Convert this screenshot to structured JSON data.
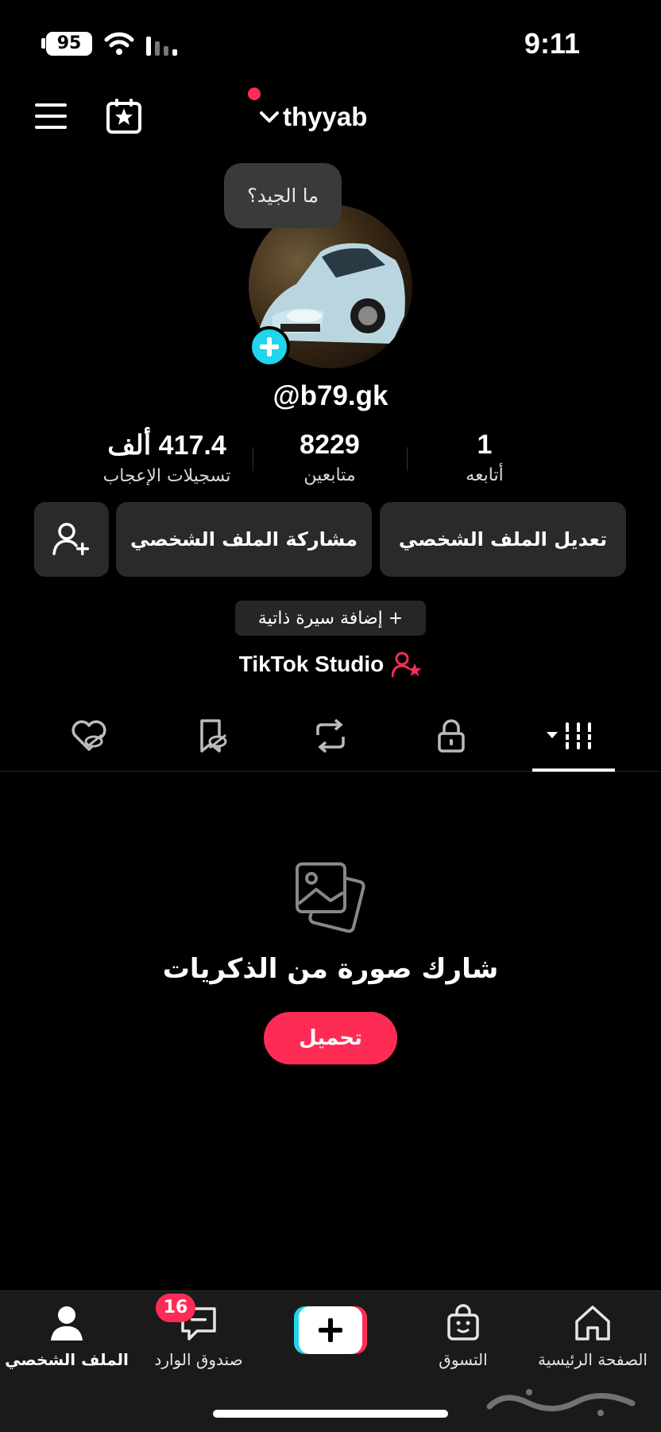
{
  "status_bar": {
    "battery": "95",
    "time": "9:11"
  },
  "header": {
    "username": "thyyab"
  },
  "profile": {
    "bubble_text": "ما الجيد؟",
    "handle": "@b79.gk",
    "stats": [
      {
        "value": "417.4 ألف",
        "label": "تسجيلات الإعجاب"
      },
      {
        "value": "8229",
        "label": "متابعين"
      },
      {
        "value": "1",
        "label": "أتابعه"
      }
    ],
    "edit_label": "تعديل الملف الشخصي",
    "share_label": "مشاركة الملف الشخصي",
    "bio_label": "+ إضافة سيرة ذاتية",
    "studio_label": "TikTok Studio"
  },
  "tabs": [
    "grid",
    "private",
    "reposts",
    "favorites",
    "liked"
  ],
  "empty_state": {
    "title": "شارك صورة من الذكريات",
    "button": "تحميل"
  },
  "bottom_nav": {
    "home": "الصفحة الرئيسية",
    "shop": "التسوق",
    "inbox": "صندوق الوارد",
    "inbox_badge": "16",
    "profile": "الملف الشخصي"
  },
  "colors": {
    "accent": "#fe2c55",
    "cyan": "#20d5ec",
    "background": "#000000"
  }
}
